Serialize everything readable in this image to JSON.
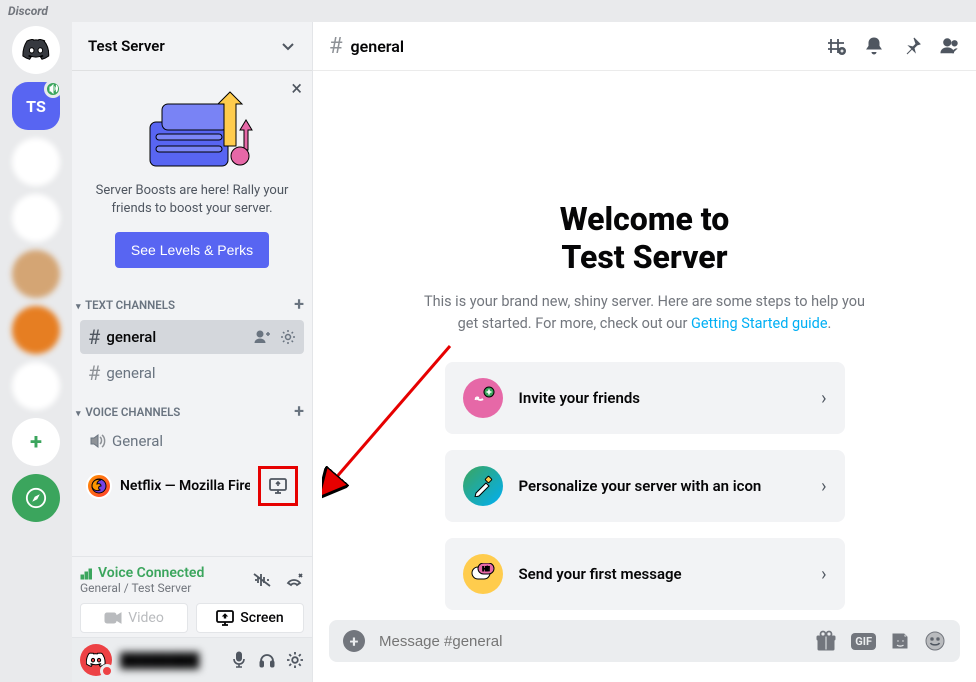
{
  "app_title": "Discord",
  "servers": {
    "home_initials": "",
    "active_initials": "TS",
    "add_label": "+",
    "explore_label": ""
  },
  "sidebar": {
    "server_name": "Test Server",
    "boost": {
      "text": "Server Boosts are here! Rally your friends to boost your server.",
      "button": "See Levels & Perks"
    },
    "text_channels_header": "TEXT CHANNELS",
    "voice_channels_header": "VOICE CHANNELS",
    "text_channels": [
      {
        "name": "general",
        "selected": true
      },
      {
        "name": "general",
        "selected": false
      }
    ],
    "voice_channels": [
      {
        "name": "General"
      }
    ],
    "stream": {
      "title": "Netflix — Mozilla Firefox"
    },
    "voice_status": {
      "state": "Voice Connected",
      "subtext": "General / Test Server",
      "video_label": "Video",
      "screen_label": "Screen"
    },
    "user": {
      "name": "████████"
    }
  },
  "header": {
    "channel_name": "general"
  },
  "welcome": {
    "heading_line1": "Welcome to",
    "heading_line2": "Test Server",
    "subtext_pre": "This is your brand new, shiny server. Here are some steps to help you get started. For more, check out our ",
    "subtext_link": "Getting Started guide",
    "subtext_post": ".",
    "cards": [
      {
        "label": "Invite your friends"
      },
      {
        "label": "Personalize your server with an icon"
      },
      {
        "label": "Send your first message"
      }
    ]
  },
  "composer": {
    "placeholder": "Message #general",
    "gif_label": "GIF"
  }
}
